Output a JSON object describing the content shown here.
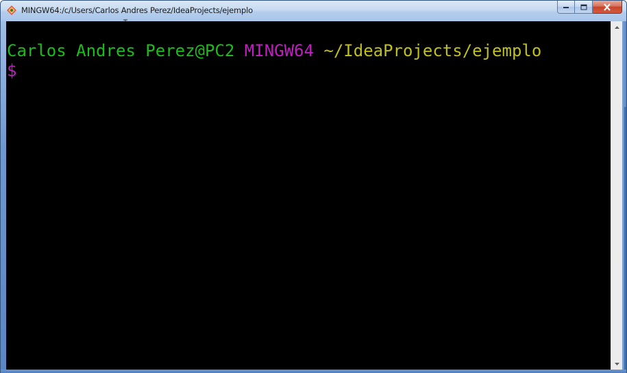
{
  "window": {
    "title": "MINGW64:/c/Users/Carlos Andres Perez/IdeaProjects/ejemplo",
    "app_icon": "git-bash-icon"
  },
  "caption_buttons": {
    "minimize_icon": "minimize-icon",
    "maximize_icon": "maximize-icon",
    "close_icon": "close-icon"
  },
  "terminal": {
    "prompt_user_host": "Carlos Andres Perez@PC2",
    "prompt_system": "MINGW64",
    "prompt_path": "~/IdeaProjects/ejemplo",
    "prompt_symbol": "$",
    "colors": {
      "background": "#000000",
      "user_host": "#1dbb1d",
      "system": "#bf1fbf",
      "path": "#bfbf1f",
      "prompt_symbol": "#bf1fbf"
    }
  },
  "scrollbar": {
    "up_icon": "scroll-up-arrow-icon",
    "down_icon": "scroll-down-arrow-icon"
  }
}
